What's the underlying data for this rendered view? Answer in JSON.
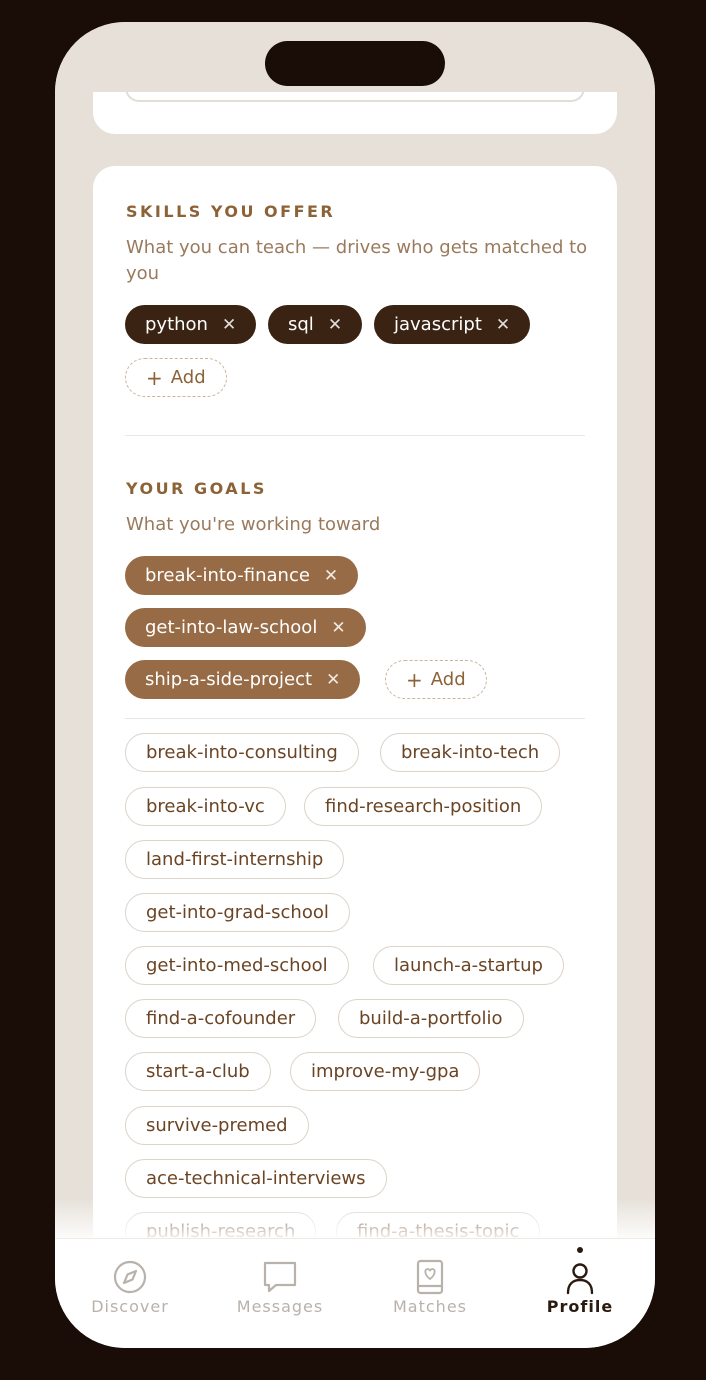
{
  "skills": {
    "title": "SKILLS YOU OFFER",
    "description": "What you can teach — drives who gets matched to you",
    "items": [
      "python",
      "sql",
      "javascript"
    ],
    "add_label": "Add"
  },
  "goals": {
    "title": "YOUR GOALS",
    "description": "What you're working toward",
    "selected": [
      "break-into-finance",
      "get-into-law-school",
      "ship-a-side-project"
    ],
    "add_label": "Add",
    "suggestions": [
      "break-into-consulting",
      "break-into-tech",
      "break-into-vc",
      "find-research-position",
      "land-first-internship",
      "get-into-grad-school",
      "get-into-med-school",
      "launch-a-startup",
      "find-a-cofounder",
      "build-a-portfolio",
      "start-a-club",
      "improve-my-gpa",
      "survive-premed",
      "ace-technical-interviews",
      "publish-research",
      "find-a-thesis-topic"
    ]
  },
  "tabbar": {
    "items": [
      {
        "label": "Discover",
        "icon": "compass-icon",
        "active": false
      },
      {
        "label": "Messages",
        "icon": "chat-bubble-icon",
        "active": false
      },
      {
        "label": "Matches",
        "icon": "heart-card-icon",
        "active": false
      },
      {
        "label": "Profile",
        "icon": "person-icon",
        "active": true
      }
    ]
  },
  "colors": {
    "skill_pill": "#3a2313",
    "goal_pill": "#976b45",
    "accent": "#8c6237",
    "background": "#e6e0d9"
  }
}
